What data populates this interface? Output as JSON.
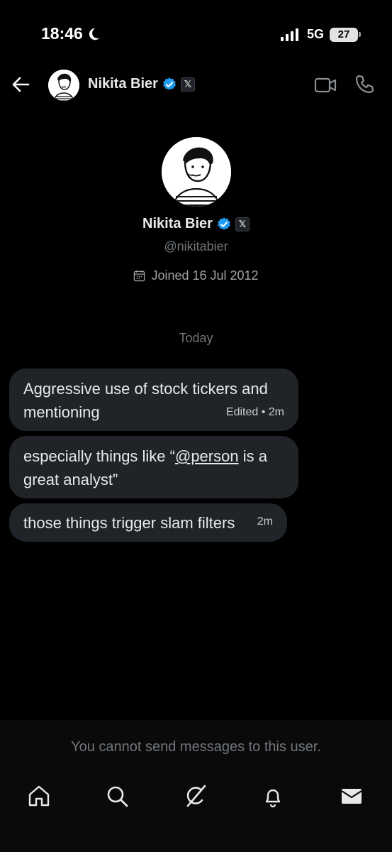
{
  "status_bar": {
    "time": "18:46",
    "network": "5G",
    "battery": "27"
  },
  "header": {
    "name": "Nikita Bier",
    "x_badge": "𝕏"
  },
  "profile": {
    "name": "Nikita Bier",
    "handle": "@nikitabier",
    "joined": "Joined 16 Jul 2012",
    "x_badge": "𝕏"
  },
  "date_divider": "Today",
  "messages": [
    {
      "text": "Aggressive use of stock tickers and mentioning",
      "meta": "Edited • 2m"
    },
    {
      "text_before": "especially things like “",
      "mention": "@person",
      "text_after": " is a great analyst”"
    },
    {
      "text": "those things trigger slam filters",
      "meta": "2m"
    }
  ],
  "composer_notice": "You cannot send messages to this user.",
  "colors": {
    "background": "#000000",
    "bubble": "#202327",
    "muted_text": "#71767b",
    "verified": "#1d9bf0"
  },
  "icons": {
    "back": "arrow-left-icon",
    "video": "video-camera-icon",
    "call": "phone-icon",
    "verified": "verified-badge-icon",
    "calendar": "calendar-icon",
    "nav": [
      "home-icon",
      "search-icon",
      "grok-icon",
      "bell-icon",
      "envelope-icon"
    ]
  }
}
